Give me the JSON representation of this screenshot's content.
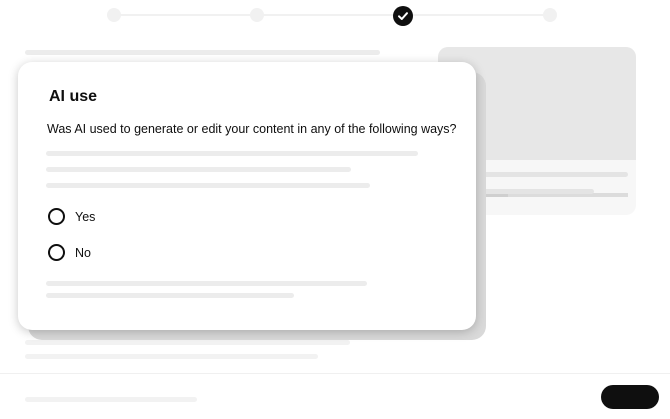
{
  "stepper": {
    "steps": [
      "step-1",
      "step-2",
      "step-3",
      "step-4"
    ],
    "current_step": 3,
    "active_icon": "checkmark-icon"
  },
  "dialog": {
    "title": "AI use",
    "question": "Was AI used to generate or edit your content in any of the following ways?",
    "options": [
      {
        "label": "Yes",
        "selected": false
      },
      {
        "label": "No",
        "selected": false
      }
    ]
  },
  "colors": {
    "primary": "#0f0f0f",
    "skeleton": "#ececec",
    "background": "#ffffff"
  }
}
